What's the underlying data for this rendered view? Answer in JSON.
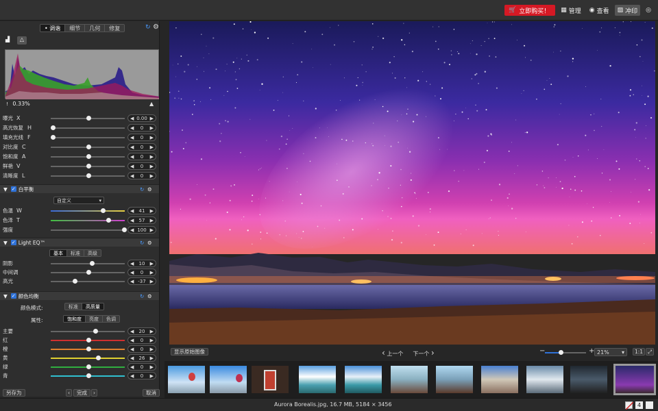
{
  "topbar": {
    "buy_label": "立即购买！",
    "manage_label": "管理",
    "view_label": "查看",
    "print_label": "冲印"
  },
  "left_tabs": [
    "调谐",
    "细节",
    "几何",
    "修复"
  ],
  "histogram": {
    "clip_value": "0.33%"
  },
  "basic_sliders": [
    {
      "label": "曝光",
      "key": "X",
      "value": "0.00",
      "level": 0.5
    },
    {
      "label": "高光恢复",
      "key": "H",
      "value": "0",
      "level": 0.0
    },
    {
      "label": "填充光线",
      "key": "F",
      "value": "0",
      "level": 0.0
    },
    {
      "label": "对比度",
      "key": "C",
      "value": "0",
      "level": 0.5
    },
    {
      "label": "饱和度",
      "key": "A",
      "value": "0",
      "level": 0.5
    },
    {
      "label": "鲜艳",
      "key": "V",
      "value": "0",
      "level": 0.5
    },
    {
      "label": "清晰度",
      "key": "L",
      "value": "0",
      "level": 0.5
    }
  ],
  "white_balance": {
    "title": "白平衡",
    "preset": "自定义",
    "sliders": [
      {
        "label": "色温",
        "key": "W",
        "value": "41",
        "level": 0.7
      },
      {
        "label": "色泽",
        "key": "T",
        "value": "57",
        "level": 0.78
      },
      {
        "label": "强度",
        "key": "",
        "value": "100",
        "level": 1.0
      }
    ]
  },
  "light_eq": {
    "title": "Light EQ™",
    "modes": [
      "基本",
      "标准",
      "高级"
    ],
    "sliders": [
      {
        "label": "阴影",
        "value": "10",
        "level": 0.55
      },
      {
        "label": "中间调",
        "value": "0",
        "level": 0.5
      },
      {
        "label": "高光",
        "value": "-37",
        "level": 0.31
      }
    ]
  },
  "color_balance": {
    "title": "颜色均衡",
    "mode_label": "颜色模式:",
    "modes": [
      "标准",
      "高质量"
    ],
    "attr_label": "属性:",
    "attrs": [
      "饱和度",
      "亮度",
      "色调"
    ],
    "sliders": [
      {
        "label": "主要",
        "value": "20",
        "level": 0.6
      },
      {
        "label": "红",
        "value": "0",
        "level": 0.5
      },
      {
        "label": "橙",
        "value": "0",
        "level": 0.5
      },
      {
        "label": "黄",
        "value": "26",
        "level": 0.63
      },
      {
        "label": "绿",
        "value": "0",
        "level": 0.5
      },
      {
        "label": "青",
        "value": "0",
        "level": 0.5
      }
    ]
  },
  "bottom_left": {
    "save_as": "另存为",
    "done": "完成",
    "cancel": "取消"
  },
  "viewer_toolbar": {
    "show_original": "显示原始图像",
    "prev": "上一个",
    "next": "下一个",
    "zoom": "21%",
    "zoom_level": 0.38,
    "one_to_one": "1:1"
  },
  "status": {
    "file_info": "Aurora Borealis.jpg, 16.7 MB, 5184 × 3456",
    "rating_count": "4"
  }
}
